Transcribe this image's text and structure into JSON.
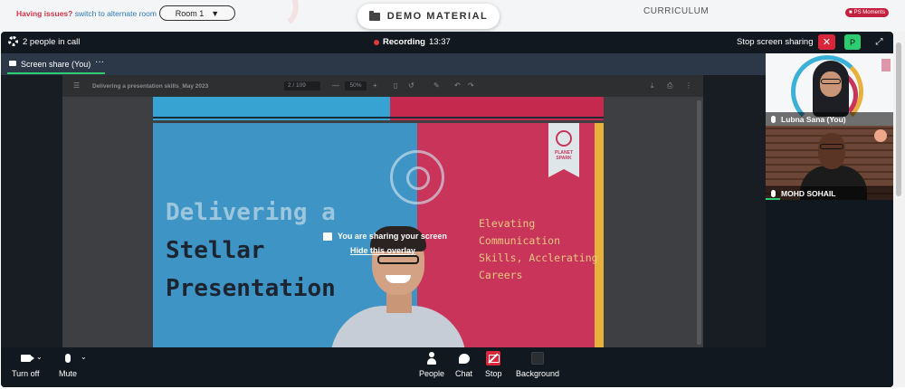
{
  "topbar": {
    "issues_text": "Having issues?",
    "alternate_link": "switch to alternate room",
    "room_value": "Room 1",
    "demo_label": "DEMO MATERIAL",
    "curriculum_label": "CURRICULUM",
    "ps_badge": "PS Moments"
  },
  "call": {
    "people_count": "2 people in call",
    "recording_label": "Recording",
    "recording_time": "13:37",
    "stop_sharing_label": "Stop screen sharing",
    "close_glyph": "✕",
    "avatar_initial": "P",
    "expand_glyph": "⤢"
  },
  "share_tab": {
    "label": "Screen share (You)",
    "more": "···"
  },
  "pdf": {
    "filename": "Delivering a presentation skills_May 2023",
    "page": "2 / 109",
    "zoom": "50%"
  },
  "slide": {
    "headline_line1": "Delivering a",
    "headline_line2": "Stellar",
    "headline_line3": "Presentation",
    "tagline": [
      "Elevating",
      "Communication",
      "Skills, Acclerating",
      "Careers"
    ],
    "brand": "PLANET SPARK"
  },
  "overlay": {
    "sharing_text": "You are sharing your screen",
    "hide_link": "Hide this overlay"
  },
  "participants": [
    {
      "name": "Lubna Sana (You)"
    },
    {
      "name": "MOHD SOHAIL"
    }
  ],
  "controls": {
    "camera": "Turn off",
    "mute": "Mute",
    "people": "People",
    "chat": "Chat",
    "stop": "Stop",
    "background": "Background"
  },
  "colors": {
    "accent_green": "#2ecc71",
    "danger_red": "#d9263b",
    "slide_blue": "#3e94c4",
    "slide_red": "#c9355a",
    "slide_gold": "#e8b13b"
  }
}
